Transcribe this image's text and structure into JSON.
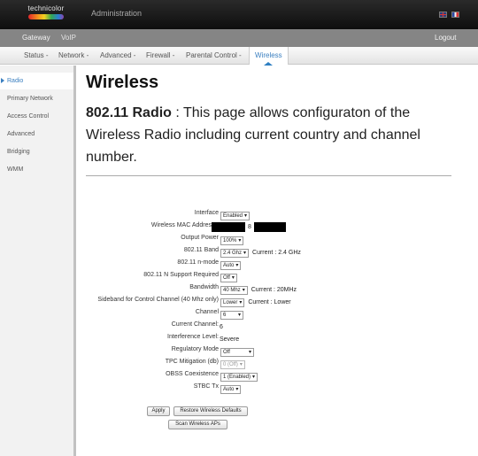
{
  "header": {
    "logo_text": "technicolor",
    "admin_title": "Administration",
    "flags": [
      "uk-flag-icon",
      "fr-flag-icon"
    ]
  },
  "nav": {
    "gateway": "Gateway",
    "voip": "VoIP",
    "logout": "Logout"
  },
  "subnav": {
    "items": [
      "Status -",
      "Network -",
      "Advanced -",
      "Firewall -",
      "Parental Control -"
    ],
    "active": "Wireless"
  },
  "sidebar": {
    "items": [
      "Radio",
      "Primary Network",
      "Access Control",
      "Advanced",
      "Bridging",
      "WMM"
    ],
    "active_index": 0
  },
  "page": {
    "title": "Wireless",
    "desc_bold": "802.11 Radio",
    "desc_rest": " :  This page allows configuraton of the Wireless Radio including current country and channel number."
  },
  "form": {
    "interface_label": "Interface",
    "interface_value": "Enabled",
    "mac_label": "Wireless MAC Addres",
    "mac_mid": "8",
    "output_power_label": "Output Power",
    "output_power_value": "100%",
    "band_label": "802.11 Band",
    "band_value": "2.4 Ghz",
    "band_current": "Current :  2.4 GHz",
    "nmode_label": "802.11 n-mode",
    "nmode_value": "Auto",
    "nsupport_label": "802.11 N Support Required",
    "nsupport_value": "Off",
    "bandwidth_label": "Bandwidth",
    "bandwidth_value": "40 Mhz",
    "bandwidth_current": "Current :  20MHz",
    "sideband_label": "Sideband for Control Channel (40 Mhz only)",
    "sideband_value": "Lower",
    "sideband_current": "Current : Lower",
    "channel_label": "Channel",
    "channel_value": "6",
    "current_channel_label": "Current Channel:",
    "current_channel_value": "6",
    "interference_label": "Interference Level:",
    "interference_value": "Severe",
    "regulatory_label": "Regulatory Mode",
    "regulatory_value": "Off",
    "tpc_label": "TPC Mitigation (db)",
    "tpc_value": "0 (Off)",
    "obss_label": "OBSS Coexistence",
    "obss_value": "1 (Enabled)",
    "stbc_label": "STBC Tx",
    "stbc_value": "Auto"
  },
  "buttons": {
    "apply": "Apply",
    "restore": "Restore Wireless Defaults",
    "scan": "Scan Wireless APs"
  },
  "dropdown_arrow": "▾"
}
